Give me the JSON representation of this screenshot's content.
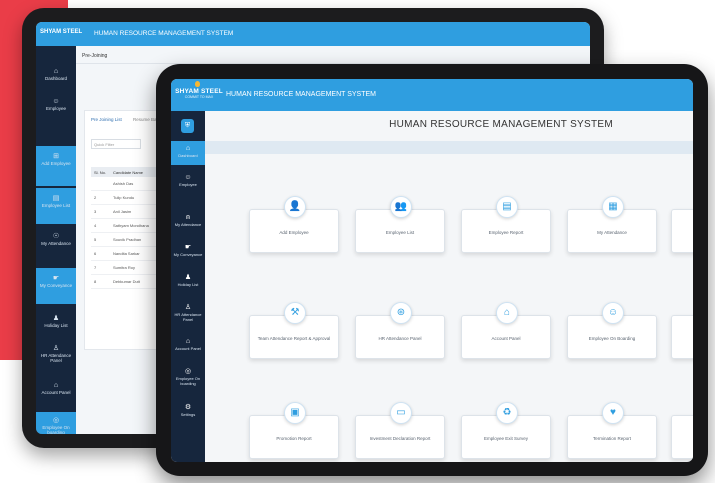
{
  "back": {
    "brand": "SHYAM STEEL",
    "title": "HUMAN RESOURCE MANAGEMENT SYSTEM",
    "breadcrumb": "Pre-Joining",
    "tabs": [
      "Pre Joining List",
      "Resume Bank"
    ],
    "filter_placeholder": "Quick Filter",
    "table_header": [
      "Sl. No.",
      "Candidate Name"
    ],
    "rows": [
      [
        "",
        "Ashish Das"
      ],
      [
        "2",
        "Tulip Kundu"
      ],
      [
        "3",
        "Anil Jasim"
      ],
      [
        "4",
        "Sathyam Mondhana"
      ],
      [
        "5",
        "Souvik Pradhan"
      ],
      [
        "6",
        "Nandita Sarkar"
      ],
      [
        "7",
        "Sumitra Roy"
      ],
      [
        "8",
        "Debkumar Dutt"
      ]
    ],
    "sidebar": [
      {
        "icon": "⌂",
        "label": "Dashboard"
      },
      {
        "icon": "☺",
        "label": "Employee"
      },
      {
        "icon": "⊞",
        "label": "Add Employee"
      },
      {
        "icon": "▤",
        "label": "Employee List"
      },
      {
        "icon": "☉",
        "label": "My Attendance"
      },
      {
        "icon": "☛",
        "label": "My Conveyance"
      },
      {
        "icon": "♟",
        "label": "Holiday List"
      },
      {
        "icon": "♙",
        "label": "HR Attendance Panel"
      },
      {
        "icon": "⌂",
        "label": "Account Panel"
      },
      {
        "icon": "◎",
        "label": "Employee On boarding"
      }
    ]
  },
  "front": {
    "brand": "SHYAM STEEL",
    "brand_sub": "COMMIT TO MAX",
    "title": "HUMAN RESOURCE MANAGEMENT SYSTEM",
    "heading": "HUMAN RESOURCE MANAGEMENT SYSTEM",
    "sidebar": [
      {
        "icon": "⌂",
        "label": "Dashboard"
      },
      {
        "icon": "☺",
        "label": "Employee"
      },
      {
        "icon": "⍝",
        "label": "My Attendance"
      },
      {
        "icon": "☛",
        "label": "My Conveyance"
      },
      {
        "icon": "♟",
        "label": "Holiday List"
      },
      {
        "icon": "♙",
        "label": "HR Attendance Panel"
      },
      {
        "icon": "⌂",
        "label": "Account Panel"
      },
      {
        "icon": "◎",
        "label": "Employee On boarding"
      },
      {
        "icon": "⚙",
        "label": "Settings"
      }
    ],
    "tiles": [
      {
        "icon": "user-plus-icon",
        "glyph": "👤",
        "label": "Add Employee"
      },
      {
        "icon": "group-icon",
        "glyph": "👥",
        "label": "Employee List"
      },
      {
        "icon": "report-icon",
        "glyph": "▤",
        "label": "Employee Report"
      },
      {
        "icon": "calendar-icon",
        "glyph": "▦",
        "label": "My Attendance"
      },
      {
        "icon": "gavel-icon",
        "glyph": "⚒",
        "label": "Team Attendance Report & Approval"
      },
      {
        "icon": "hr-panel-icon",
        "glyph": "⊛",
        "label": "HR Attendance Panel"
      },
      {
        "icon": "bank-icon",
        "glyph": "⌂",
        "label": "Account Panel"
      },
      {
        "icon": "onboarding-icon",
        "glyph": "☺",
        "label": "Employee On Boarding"
      },
      {
        "icon": "document-icon",
        "glyph": "▣",
        "label": "Promotion Report"
      },
      {
        "icon": "investment-icon",
        "glyph": "▭",
        "label": "Investment Declaration Report"
      },
      {
        "icon": "recycle-icon",
        "glyph": "♻",
        "label": "Employee Exit Survey"
      },
      {
        "icon": "heart-icon",
        "glyph": "♥",
        "label": "Termination Report"
      }
    ]
  }
}
